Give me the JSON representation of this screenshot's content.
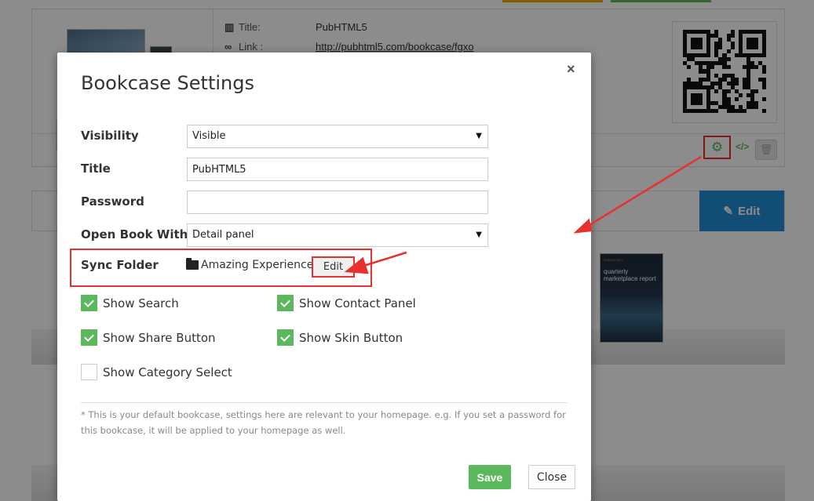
{
  "background": {
    "info": {
      "title_label": "Title:",
      "title_value": "PubHTML5",
      "link_label": "Link :",
      "link_value": "http://pubhtml5.com/bookcase/fgxo"
    },
    "edit_button_label": "Edit",
    "book_cover": {
      "publisher_line": "RNEAGENCY",
      "title": "quarterly marketplace report"
    }
  },
  "modal": {
    "title": "Bookcase Settings",
    "close_glyph": "×",
    "fields": {
      "visibility": {
        "label": "Visibility",
        "value": "Visible"
      },
      "title": {
        "label": "Title",
        "value": "PubHTML5"
      },
      "password": {
        "label": "Password",
        "value": ""
      },
      "open_book_with": {
        "label": "Open Book With",
        "value": "Detail panel"
      },
      "sync_folder": {
        "label": "Sync Folder",
        "folder": "Amazing Experience",
        "edit_label": "Edit"
      }
    },
    "options": {
      "show_search": {
        "label": "Show Search",
        "checked": true
      },
      "show_contact_panel": {
        "label": "Show Contact Panel",
        "checked": true
      },
      "show_share_button": {
        "label": "Show Share Button",
        "checked": true
      },
      "show_skin_button": {
        "label": "Show Skin Button",
        "checked": true
      },
      "show_category_select": {
        "label": "Show Category Select",
        "checked": false
      }
    },
    "note": "* This is your default bookcase, settings here are relevant to your homepage. e.g. If you set a password for this bookcase, it will be applied to your homepage as well.",
    "save_label": "Save",
    "close_label": "Close"
  },
  "colors": {
    "accent_green": "#5cb85c",
    "highlight_red": "#e8302e",
    "edit_blue": "#1f8dd6"
  }
}
